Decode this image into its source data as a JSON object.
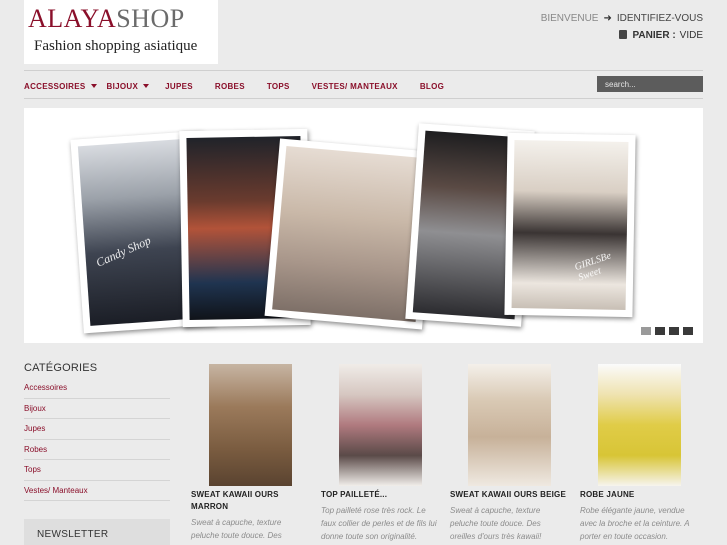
{
  "header": {
    "logo_brand_part1": "ALAYA",
    "logo_brand_part2": "SHOP",
    "logo_tagline": "Fashion shopping asiatique",
    "welcome": "BIENVENUE",
    "login": "IDENTIFIEZ-VOUS",
    "cart_label": "PANIER :",
    "cart_value": "VIDE"
  },
  "nav": {
    "items": [
      "ACCESSOIRES",
      "BIJOUX",
      "JUPES",
      "ROBES",
      "TOPS",
      "VESTES/ MANTEAUX",
      "BLOG"
    ],
    "search_placeholder": "search..."
  },
  "slider": {
    "photo_caption_1": "Candy Shop",
    "photo_caption_5": "GIRLSBe Sweet",
    "active_dot": 1,
    "dot_count": 4
  },
  "sidebar": {
    "categories_title": "CATÉGORIES",
    "categories": [
      "Accessoires",
      "Bijoux",
      "Jupes",
      "Robes",
      "Tops",
      "Vestes/ Manteaux"
    ],
    "newsletter_title": "NEWSLETTER"
  },
  "products": [
    {
      "name": "SWEAT KAWAII OURS MARRON",
      "desc": "Sweat à capuche, texture peluche toute douce. Des"
    },
    {
      "name": "TOP PAILLETÉ...",
      "desc": "Top pailleté rose très rock. Le faux collier de perles et de fils lui donne toute son originalité."
    },
    {
      "name": "SWEAT KAWAII OURS BEIGE",
      "desc": "Sweat à capuche, texture peluche toute douce. Des oreilles d'ours très kawaii!"
    },
    {
      "name": "ROBE JAUNE",
      "desc": "Robe élégante jaune, vendue avec la broche et la ceinture. A porter en toute occasion."
    }
  ],
  "colors": {
    "accent": "#8a0f2a",
    "background": "#ebebeb",
    "search_bg": "#5c5c5c"
  }
}
